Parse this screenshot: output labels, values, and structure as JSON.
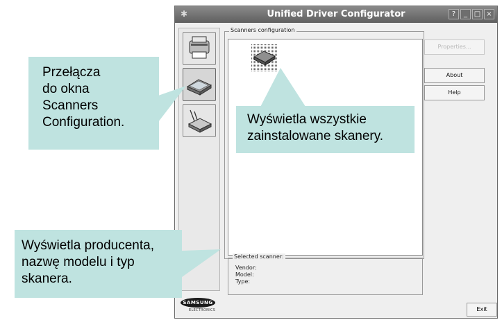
{
  "window": {
    "title": "Unified Driver Configurator",
    "controls": [
      "?",
      "_",
      "□",
      "×"
    ]
  },
  "sidebar": {
    "items": [
      {
        "name": "printers-configuration",
        "icon": "printer-icon"
      },
      {
        "name": "scanners-configuration",
        "icon": "scanner-icon",
        "active": true
      },
      {
        "name": "ports-configuration",
        "icon": "port-icon"
      }
    ]
  },
  "scanners_group": {
    "legend": "Scanners configuration",
    "device_icon": "scanner-device-icon"
  },
  "buttons": {
    "properties": "Properties...",
    "about": "About",
    "help": "Help",
    "exit": "Exit"
  },
  "selected_group": {
    "legend": "Selected scanner:",
    "vendor_label": "Vendor:",
    "model_label": "Model:",
    "type_label": "Type:"
  },
  "logo": {
    "text": "SAMSUNG",
    "subtext": "ELECTRONICS"
  },
  "callouts": {
    "sidebar": [
      "Przełącza",
      "do okna",
      "Scanners",
      "Configuration."
    ],
    "list": [
      "Wyświetla wszystkie",
      "zainstalowane skanery."
    ],
    "selected": [
      "Wyświetla producenta,",
      "nazwę modelu i typ",
      "skanera."
    ]
  },
  "colors": {
    "callout_bg": "#bfe3e0",
    "titlebar": "#6e6e6e"
  }
}
